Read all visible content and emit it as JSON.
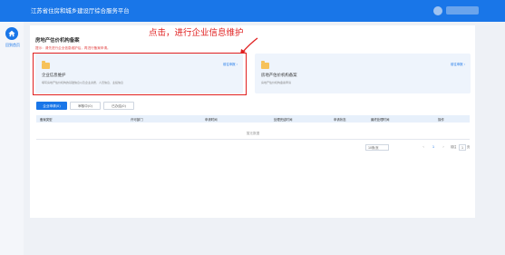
{
  "header": {
    "app_title": "江苏省住房和城乡建设厅综合服务平台"
  },
  "sidebar": {
    "home_label": "回到首页"
  },
  "main": {
    "page_title": "房地产估价机构备案",
    "tip": "提示：请先进行企业信息维护后，再进行备案申请。",
    "annotation": "点击，进行企业信息维护",
    "cards": [
      {
        "title": "企业信息维护",
        "desc": "填写房地产估价机构的基础信息以及企业资质、人员信息、业绩信息",
        "link": "前往申报 ›"
      },
      {
        "title": "房地产估价机构备案",
        "desc": "房地产估价机构备案申请",
        "link": "前往申报 ›"
      }
    ],
    "tabs": [
      "企业申请(0)",
      "审核中(0)",
      "已办结(0)"
    ],
    "table": {
      "columns": [
        "备案类型",
        "许可部门",
        "申请时间",
        "处理完结时间",
        "申请状态",
        "最终处理时间",
        "操作"
      ],
      "empty_text": "暂无数据"
    },
    "pagination": {
      "page_size": "10条/页",
      "current_page": "1",
      "goto_label": "前往",
      "goto_value": "1",
      "page_suffix": "页"
    }
  },
  "colors": {
    "primary": "#1976e8",
    "annotation": "#e02020",
    "card_bg": "#eef4fc"
  }
}
